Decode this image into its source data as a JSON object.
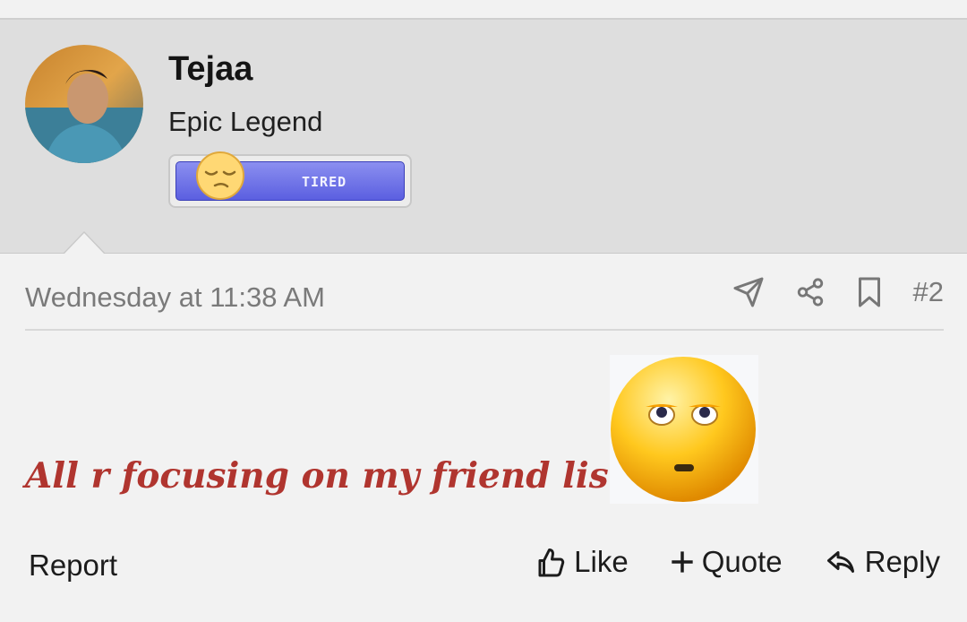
{
  "user": {
    "name": "Tejaa",
    "title": "Epic Legend",
    "mood_label": "TIRED",
    "avatar_icon": "user-avatar"
  },
  "post": {
    "timestamp": "Wednesday at 11:38 AM",
    "number": "#2",
    "message": "All r focusing on my friend list",
    "emoji_icon": "rolling-eyes-emoji"
  },
  "actions": {
    "report": "Report",
    "like": "Like",
    "quote": "Quote",
    "reply": "Reply"
  },
  "colors": {
    "message": "#b0352f",
    "mood_bar": "#5b5fe0"
  }
}
